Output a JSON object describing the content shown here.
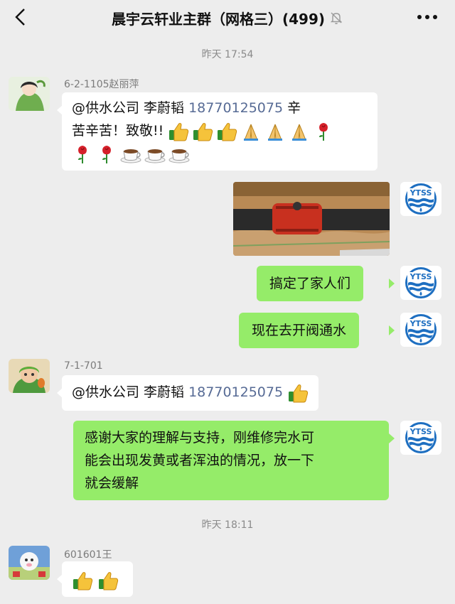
{
  "header": {
    "title": "晨宇云轩业主群（网格三）(499)",
    "back_icon": "chevron-left-icon",
    "mute_icon": "bell-muted-icon",
    "more_icon": "more-dots-icon"
  },
  "timestamps": [
    "昨天 17:54",
    "昨天 18:11"
  ],
  "messages": [
    {
      "sender": "6-2-1105赵丽萍",
      "line1_prefix": "@供水公司 李蔚韬 ",
      "line1_phone": "18770125075",
      "line1_suffix": " 辛",
      "line2_text": "苦辛苦！致敬!! ",
      "emojis_line2": [
        "thumbs-up",
        "thumbs-up",
        "thumbs-up",
        "pray",
        "pray",
        "pray",
        "rose"
      ],
      "emojis_line3": [
        "rose",
        "rose",
        "tea",
        "tea",
        "tea"
      ]
    },
    {
      "sender_avatar_text": "YTSS",
      "type": "image",
      "image_desc_icon": "photo-pipe-repair"
    },
    {
      "sender_avatar_text": "YTSS",
      "text": "搞定了家人们"
    },
    {
      "sender_avatar_text": "YTSS",
      "text": "现在去开阀通水"
    },
    {
      "sender": "7-1-701",
      "prefix": "@供水公司 李蔚韬 ",
      "phone": "18770125075",
      "emojis": [
        "thumbs-up"
      ]
    },
    {
      "sender_avatar_text": "YTSS",
      "line1": "感谢大家的理解与支持，刚维修完水可",
      "line2": "能会出现发黄或者浑浊的情况，放一下",
      "line3": "就会缓解"
    },
    {
      "sender": "601601王",
      "emojis": [
        "thumbs-up",
        "thumbs-up"
      ]
    }
  ],
  "colors": {
    "background": "#ededed",
    "bubble_green": "#95ec69",
    "bubble_white": "#ffffff",
    "phone_link": "#576b95",
    "ytss_blue": "#1e6fc1"
  }
}
